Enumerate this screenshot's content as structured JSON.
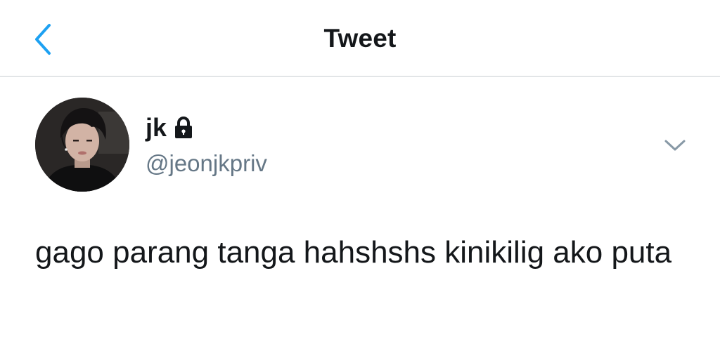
{
  "header": {
    "title": "Tweet",
    "back_icon": "chevron-left-icon",
    "accent_color": "#1da1f2"
  },
  "tweet": {
    "author": {
      "display_name": "jk",
      "protected_icon": "lock-icon",
      "username": "@jeonjkpriv",
      "avatar_icon": "avatar-photo"
    },
    "menu_icon": "chevron-down-icon",
    "text": "gago parang tanga hahshshs kinikilig ako puta"
  }
}
